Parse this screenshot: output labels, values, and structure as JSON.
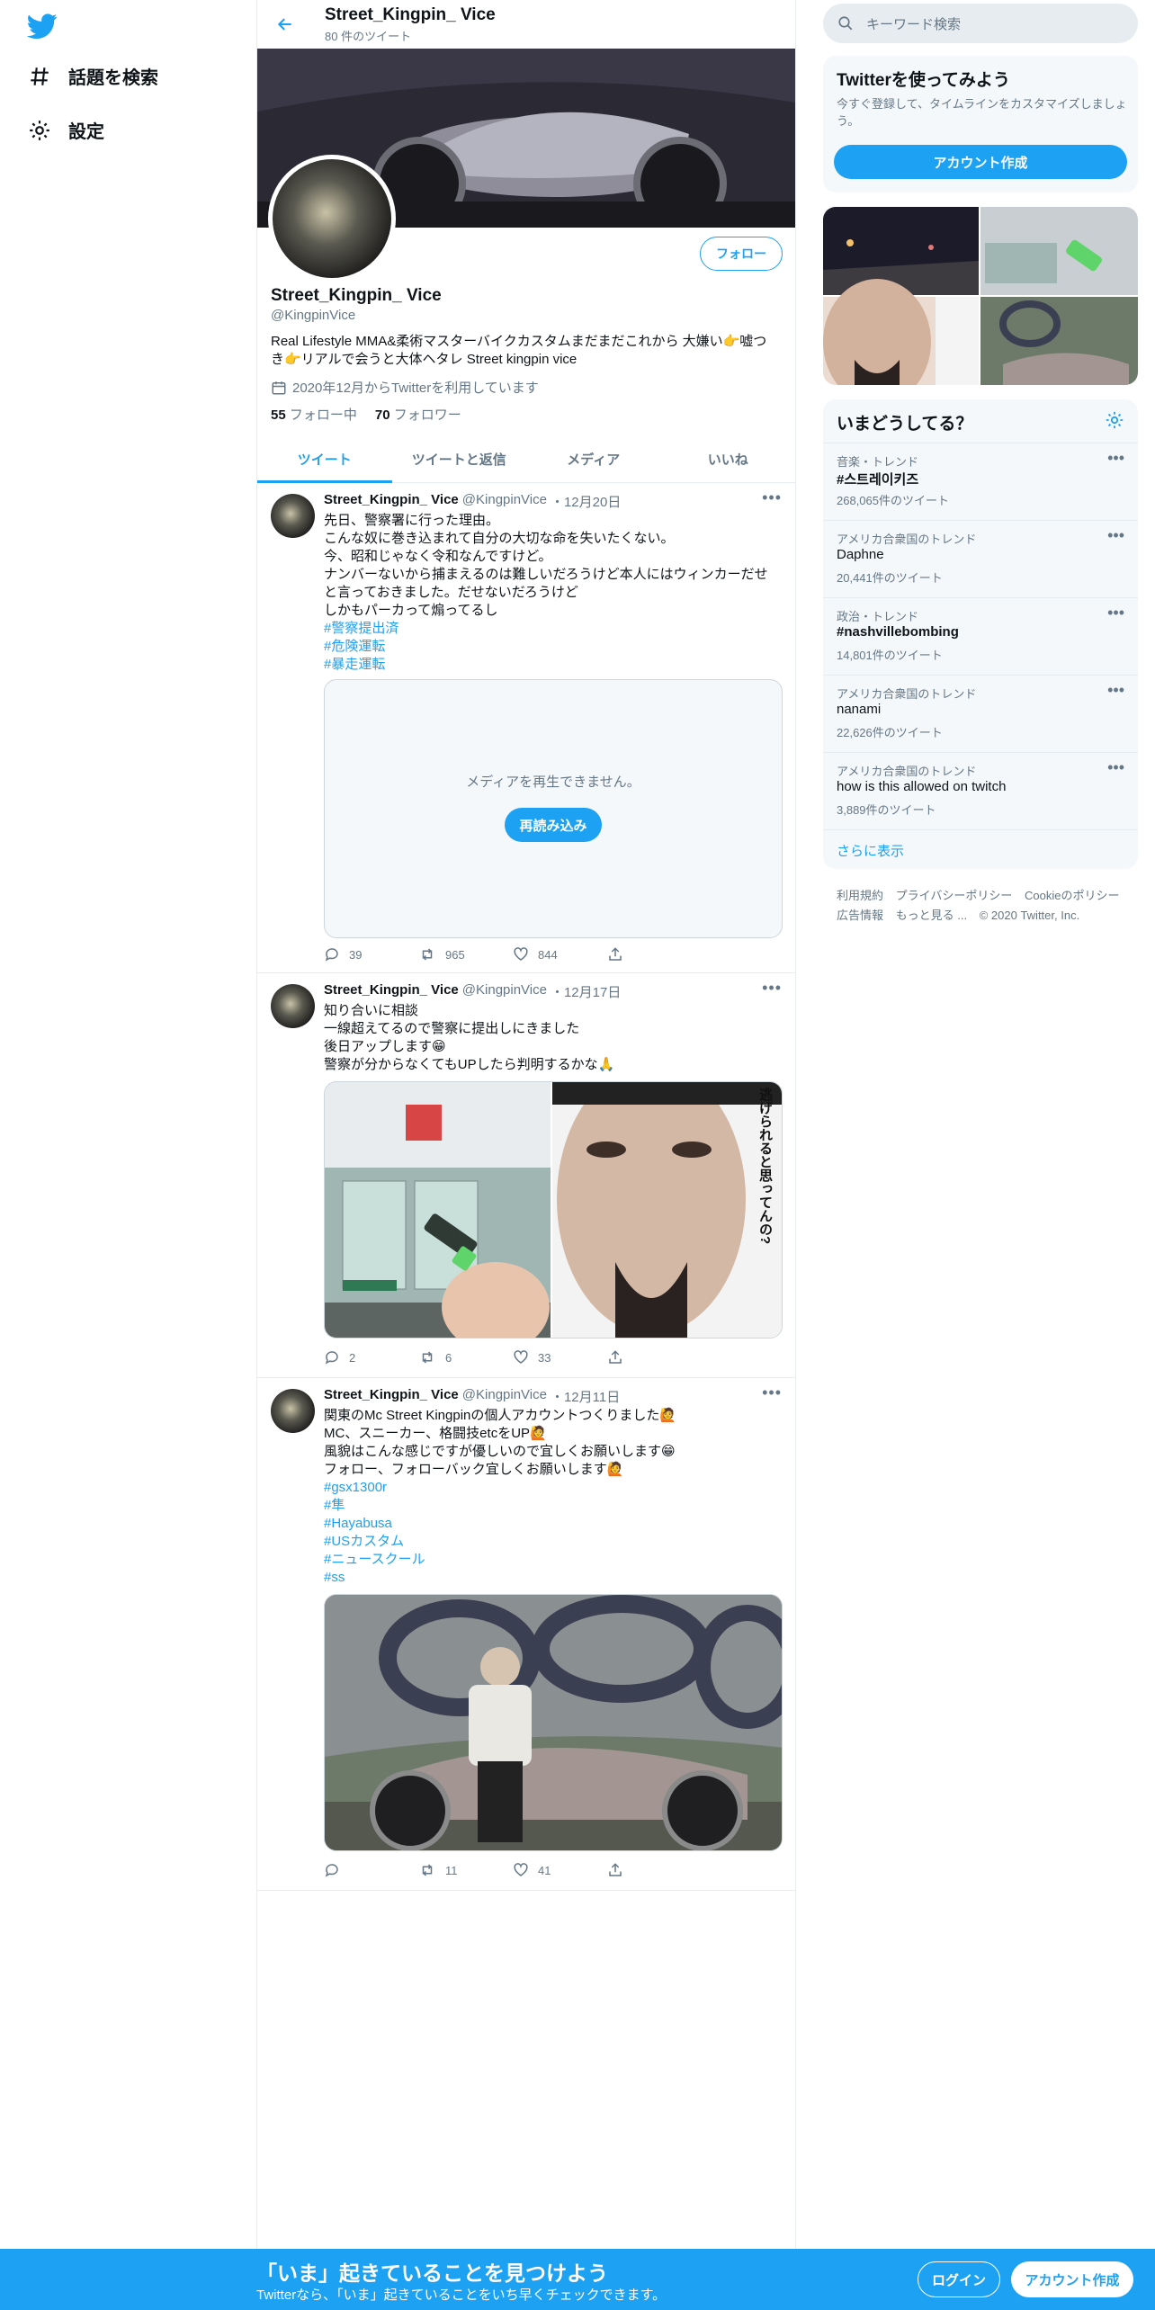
{
  "nav": {
    "explore_label": "話題を検索",
    "settings_label": "設定"
  },
  "header": {
    "name": "Street_Kingpin_ Vice",
    "tweet_count": "80 件のツイート"
  },
  "profile": {
    "follow_label": "フォロー",
    "name": "Street_Kingpin_ Vice",
    "handle": "@KingpinVice",
    "bio_line1": "Real Lifestyle MMA&柔術マスターバイクカスタムまだまだこれから 大嫌い👉嘘つ",
    "bio_line2": "き👉リアルで会うと大体ヘタレ  Street kingpin vice",
    "joined": "2020年12月からTwitterを利用しています",
    "following_count": "55",
    "following_label": "フォロー中",
    "followers_count": "70",
    "followers_label": "フォロワー"
  },
  "tabs": [
    "ツイート",
    "ツイートと返信",
    "メディア",
    "いいね"
  ],
  "tweets": [
    {
      "name": "Street_Kingpin_ Vice",
      "handle": "@KingpinVice",
      "date": "・12月20日",
      "lines": [
        "先日、警察署に行った理由。",
        "こんな奴に巻き込まれて自分の大切な命を失いたくない。",
        "今、昭和じゃなく令和なんですけど。",
        "ナンバーないから捕まえるのは難しいだろうけど本人にはウィンカーだせ",
        "と言っておきました。だせないだろうけど",
        "しかもパーカって煽ってるし"
      ],
      "hashtags": [
        "#警察提出済",
        "#危険運転",
        "#暴走運転"
      ],
      "media_error": "メディアを再生できません。",
      "reload_label": "再読み込み",
      "replies": "39",
      "retweets": "965",
      "likes": "844"
    },
    {
      "name": "Street_Kingpin_ Vice",
      "handle": "@KingpinVice",
      "date": "・12月17日",
      "lines": [
        "知り合いに相談",
        "一線超えてるので警察に提出しにきました",
        "後日アップします😁",
        "警察が分からなくてもUPしたら判明するかな🙏"
      ],
      "manga_text": "逃げられると思ってんの?",
      "replies": "2",
      "retweets": "6",
      "likes": "33"
    },
    {
      "name": "Street_Kingpin_ Vice",
      "handle": "@KingpinVice",
      "date": "・12月11日",
      "lines": [
        "関東のMc Street Kingpinの個人アカウントつくりました🙋",
        "MC、スニーカー、格闘技etcをUP🙋",
        "風貌はこんな感じですが優しいので宜しくお願いします😁",
        "フォロー、フォローバック宜しくお願いします🙋"
      ],
      "hashtags": [
        "#gsx1300r",
        "#隼",
        "#Hayabusa",
        "#USカスタム",
        "#ニュースクール",
        "#ss"
      ],
      "replies": "",
      "retweets": "11",
      "likes": "41"
    }
  ],
  "right": {
    "search_placeholder": "キーワード検索",
    "signup_card": {
      "title": "Twitterを使ってみよう",
      "desc_line1": "今すぐ登録して、タイムラインをカスタマイズしましょ",
      "desc_line2": "う。",
      "button": "アカウント作成"
    },
    "trends_title": "いまどうしてる？",
    "trends": [
      {
        "category": "音楽・トレンド",
        "name": "#스트레이키즈",
        "count": "268,065件のツイート",
        "bold": true
      },
      {
        "category": "アメリカ合衆国のトレンド",
        "name": "Daphne",
        "count": "20,441件のツイート",
        "bold": false
      },
      {
        "category": "政治・トレンド",
        "name": "#nashvillebombing",
        "count": "14,801件のツイート",
        "bold": true
      },
      {
        "category": "アメリカ合衆国のトレンド",
        "name": "nanami",
        "count": "22,626件のツイート",
        "bold": false
      },
      {
        "category": "アメリカ合衆国のトレンド",
        "name": "how is this allowed on twitch",
        "count": "3,889件のツイート",
        "bold": false
      }
    ],
    "show_more": "さらに表示",
    "footer_line1": [
      "利用規約",
      "プライバシーポリシー",
      "Cookieのポリシー"
    ],
    "footer_line2": [
      "広告情報",
      "もっと見る ...",
      "© 2020 Twitter, Inc."
    ]
  },
  "bottom": {
    "title": "「いま」起きていることを見つけよう",
    "subtitle": "Twitterなら、「いま」起きていることをいち早くチェックできます。",
    "login": "ログイン",
    "signup": "アカウント作成"
  }
}
